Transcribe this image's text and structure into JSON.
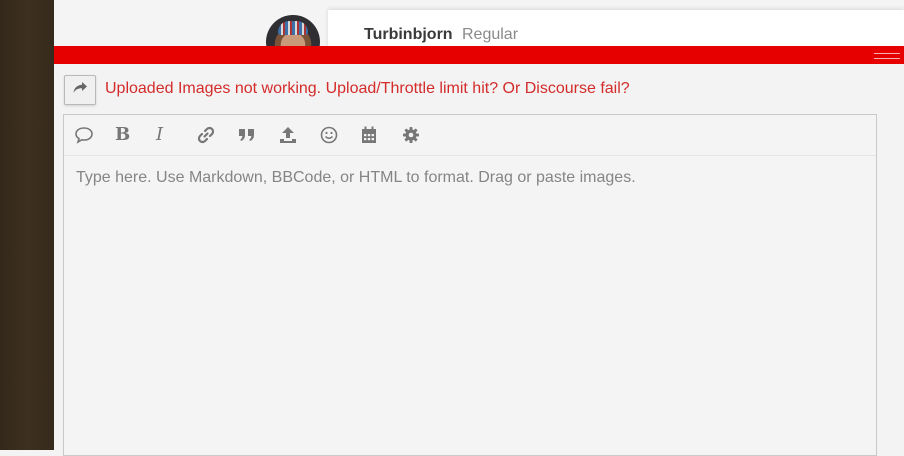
{
  "post": {
    "username": "Turbinbjorn",
    "user_title": "Regular",
    "avatar_icon": "user-avatar"
  },
  "composer": {
    "accent_color": "#e60000",
    "reply_icon": "share-arrow-icon",
    "reply_title": "Uploaded Images not working. Upload/Throttle limit hit? Or Discourse fail?",
    "editor": {
      "placeholder": "Type here. Use Markdown, BBCode, or HTML to format. Drag or paste images."
    },
    "toolbar": [
      {
        "name": "speech-bubble-icon",
        "label": ""
      },
      {
        "name": "bold-icon",
        "label": "B"
      },
      {
        "name": "italic-icon",
        "label": "I"
      },
      {
        "name": "link-icon",
        "label": ""
      },
      {
        "name": "quote-icon",
        "label": ""
      },
      {
        "name": "upload-icon",
        "label": ""
      },
      {
        "name": "emoji-icon",
        "label": ""
      },
      {
        "name": "calendar-icon",
        "label": ""
      },
      {
        "name": "gear-icon",
        "label": ""
      }
    ]
  }
}
